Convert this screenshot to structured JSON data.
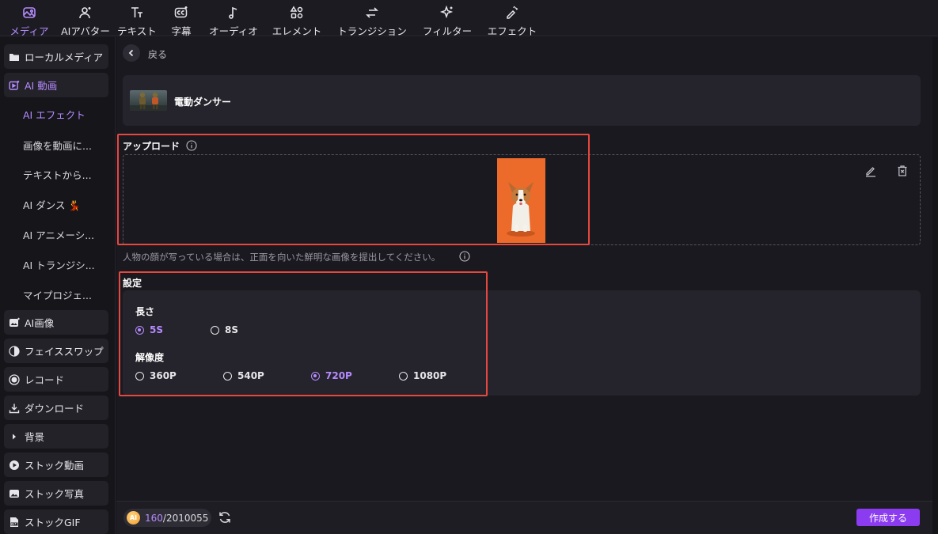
{
  "toolbar": {
    "tabs": [
      {
        "label": "メディア",
        "icon": "media-icon",
        "active": true
      },
      {
        "label": "AIアバター",
        "icon": "avatar-icon",
        "active": false
      },
      {
        "label": "テキスト",
        "icon": "text-icon",
        "active": false
      },
      {
        "label": "字幕",
        "icon": "caption-icon",
        "active": false
      },
      {
        "label": "オーディオ",
        "icon": "audio-icon",
        "active": false
      },
      {
        "label": "エレメント",
        "icon": "element-icon",
        "active": false
      },
      {
        "label": "トランジション",
        "icon": "transition-icon",
        "active": false
      },
      {
        "label": "フィルター",
        "icon": "filter-icon",
        "active": false
      },
      {
        "label": "エフェクト",
        "icon": "effect-icon",
        "active": false
      }
    ]
  },
  "sidebar": {
    "local_media": "ローカルメディア",
    "ai_video": "AI 動画",
    "sub_items": [
      "AI エフェクト",
      "画像を動画に...",
      "テキストから...",
      "AI ダンス 💃",
      "AI アニメーシ...",
      "AI トランジシ...",
      "マイプロジェ..."
    ],
    "ai_image": "AI画像",
    "face_swap": "フェイススワップ",
    "record": "レコード",
    "download": "ダウンロード",
    "background": "背景",
    "stock_video": "ストック動画",
    "stock_photo": "ストック写真",
    "stock_gif": "ストックGIF"
  },
  "main": {
    "back_label": "戻る",
    "effect_name": "電動ダンサー",
    "upload_title": "アップロード",
    "hint": "人物の顔が写っている場合は、正面を向いた鮮明な画像を提出してください。",
    "settings_title": "設定",
    "length_label": "長さ",
    "length_options": [
      "5S",
      "8S"
    ],
    "length_selected": "5S",
    "resolution_label": "解像度",
    "resolution_options": [
      "360P",
      "540P",
      "720P",
      "1080P"
    ],
    "resolution_selected": "720P"
  },
  "bottom": {
    "coin_label": "AI",
    "credits_used": "160",
    "credits_total": "/2010055",
    "create_label": "作成する"
  },
  "colors": {
    "accent": "#b58bff",
    "button": "#8b3cf0",
    "highlight": "#e5483f"
  }
}
